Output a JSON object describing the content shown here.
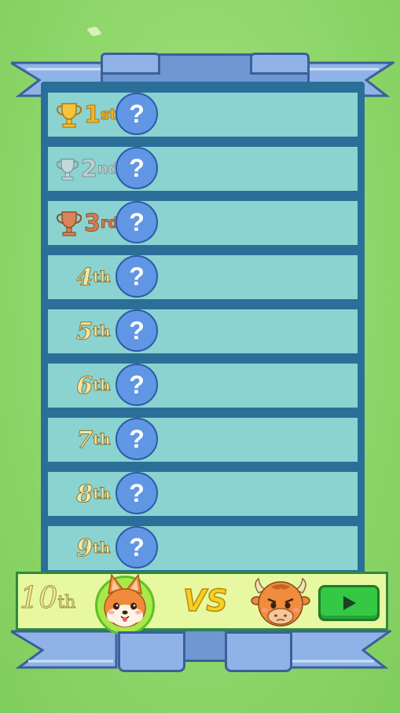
{
  "ranks": [
    {
      "num": "1",
      "suffix": "st",
      "tier": "gold",
      "player": "?"
    },
    {
      "num": "2",
      "suffix": "nd",
      "tier": "silver",
      "player": "?"
    },
    {
      "num": "3",
      "suffix": "rd",
      "tier": "bronze",
      "player": "?"
    },
    {
      "num": "4",
      "suffix": "th",
      "tier": "plain",
      "player": "?"
    },
    {
      "num": "5",
      "suffix": "th",
      "tier": "plain",
      "player": "?"
    },
    {
      "num": "6",
      "suffix": "th",
      "tier": "plain",
      "player": "?"
    },
    {
      "num": "7",
      "suffix": "th",
      "tier": "plain",
      "player": "?"
    },
    {
      "num": "8",
      "suffix": "th",
      "tier": "plain",
      "player": "?"
    },
    {
      "num": "9",
      "suffix": "th",
      "tier": "plain",
      "player": "?"
    }
  ],
  "current": {
    "num": "10",
    "suffix": "th",
    "player_icon": "shiba-dog-avatar",
    "opponent_icon": "bull-avatar"
  },
  "vs_label": "VS",
  "icons": {
    "play": "play-icon",
    "trophy": "trophy-icon"
  },
  "colors": {
    "gold": "#f2b326",
    "silver": "#b9cfd0",
    "bronze": "#d27f53",
    "row": "#8ad3d0",
    "panel": "#2b6f98",
    "play": "#35c845"
  }
}
